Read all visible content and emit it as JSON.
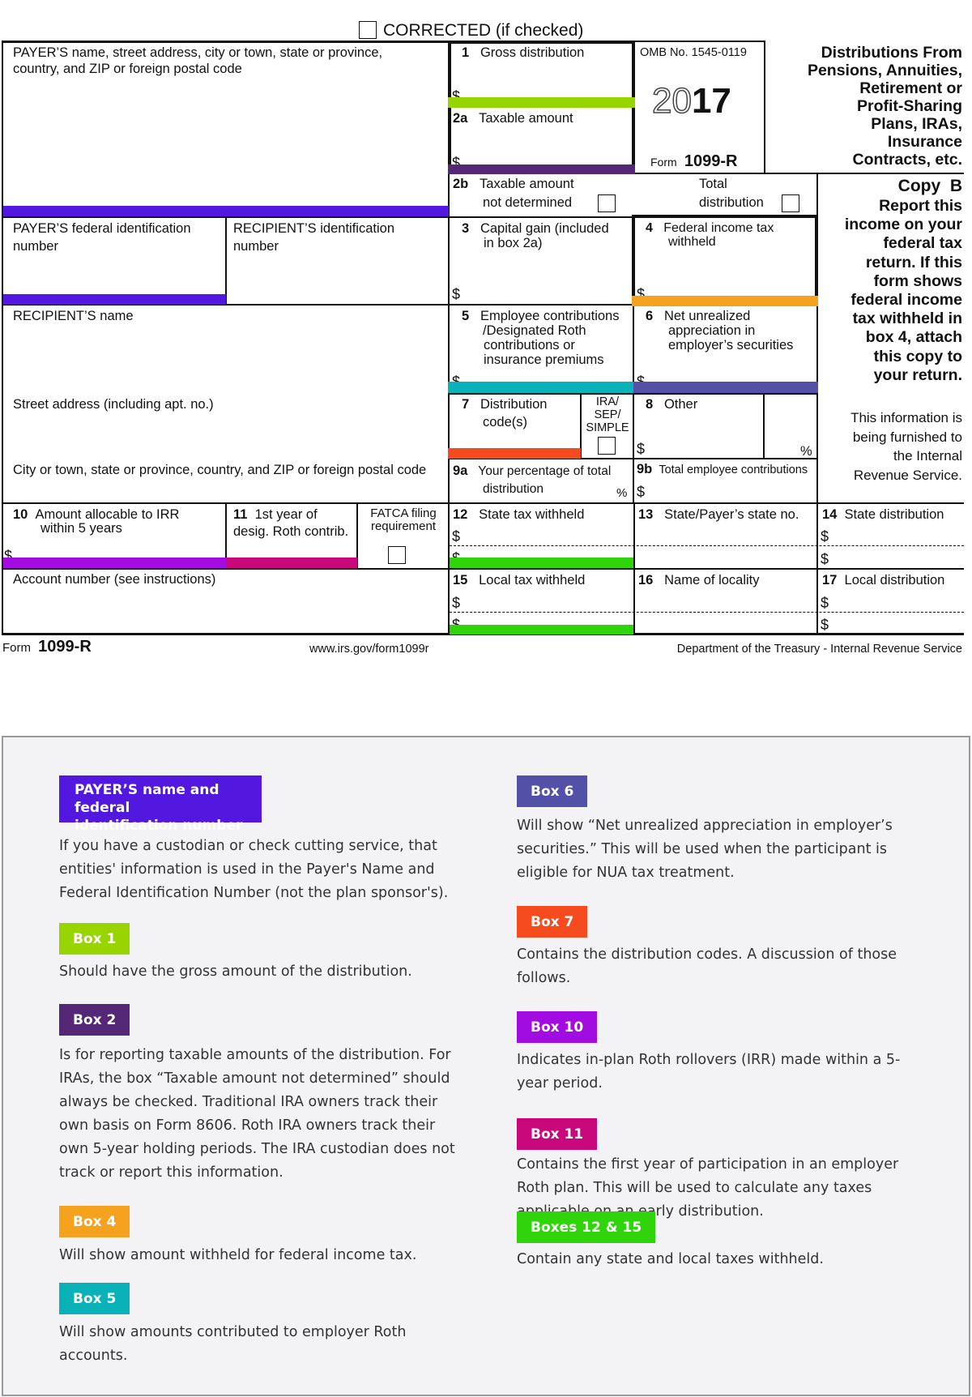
{
  "form": {
    "corrected_label": "CORRECTED (if checked)",
    "payer_name_label": "PAYER’S name, street address, city or town, state or province,",
    "payer_name_label_2": "country, and ZIP or foreign postal code",
    "payer_fed_id_label_1": "PAYER’S federal identification",
    "payer_fed_id_label_2": "number",
    "recipient_id_label_1": "RECIPIENT’S identification",
    "recipient_id_label_2": "number",
    "recipient_name_label": "RECIPIENT’S name",
    "street_label": "Street address (including apt. no.)",
    "city_label": "City or town, state or province, country, and ZIP or foreign postal code",
    "account_label": "Account number (see instructions)",
    "currency_symbol": "$",
    "percent_symbol": "%",
    "boxes": {
      "b1": {
        "num": "1",
        "label": "Gross distribution"
      },
      "b2a": {
        "num": "2a",
        "label": "Taxable amount"
      },
      "b2b": {
        "num": "2b",
        "label_1": "Taxable amount",
        "label_2": "not determined"
      },
      "total_dist": {
        "label_1": "Total",
        "label_2": "distribution"
      },
      "b3": {
        "num": "3",
        "label_1": "Capital gain (included",
        "label_2": "in box 2a)"
      },
      "b4": {
        "num": "4",
        "label_1": "Federal income tax",
        "label_2": "withheld"
      },
      "b5": {
        "num": "5",
        "label_1": "Employee contributions",
        "label_2": "/Designated Roth",
        "label_3": "contributions or",
        "label_4": "insurance premiums"
      },
      "b6": {
        "num": "6",
        "label_1": "Net unrealized",
        "label_2": "appreciation in",
        "label_3": "employer’s securities"
      },
      "b7": {
        "num": "7",
        "label_1": "Distribution",
        "label_2": "code(s)"
      },
      "ira_sep": {
        "label_1": "IRA/",
        "label_2": "SEP/",
        "label_3": "SIMPLE"
      },
      "b8": {
        "num": "8",
        "label": "Other"
      },
      "b9a": {
        "num": "9a",
        "label_1": "Your percentage of total",
        "label_2": "distribution"
      },
      "b9b": {
        "num": "9b",
        "label": "Total employee contributions"
      },
      "b10": {
        "num": "10",
        "label_1": "Amount allocable to IRR",
        "label_2": "within 5 years"
      },
      "b11": {
        "num": "11",
        "label_1": "1st year of",
        "label_2": "desig. Roth contrib."
      },
      "fatca": {
        "label_1": "FATCA filing",
        "label_2": "requirement"
      },
      "b12": {
        "num": "12",
        "label": "State tax withheld"
      },
      "b13": {
        "num": "13",
        "label": "State/Payer’s state no."
      },
      "b14": {
        "num": "14",
        "label": "State distribution"
      },
      "b15": {
        "num": "15",
        "label": "Local tax withheld"
      },
      "b16": {
        "num": "16",
        "label": "Name of locality"
      },
      "b17": {
        "num": "17",
        "label": "Local distribution"
      }
    },
    "omb": "OMB No. 1545-0119",
    "year_outline": "20",
    "year_bold": "17",
    "form_word": "Form",
    "form_number": "1099-R",
    "title_lines": [
      "Distributions From",
      "Pensions, Annuities,",
      "Retirement or",
      "Profit-Sharing",
      "Plans, IRAs,",
      "Insurance",
      "Contracts, etc."
    ],
    "copy_label": "Copy  B",
    "copy_lines": [
      "Report this",
      "income on your",
      "federal tax",
      "return. If this",
      "form shows",
      "federal income",
      "tax withheld in",
      "box 4, attach",
      "this copy to",
      "your return."
    ],
    "irs_lines": [
      "This information is",
      "being furnished to",
      "the Internal",
      "Revenue Service."
    ],
    "footer_url": "www.irs.gov/form1099r",
    "footer_dept": "Department of the Treasury - Internal Revenue Service"
  },
  "colors": {
    "payer": "#5218e0",
    "box1": "#98d400",
    "box2": "#542877",
    "box4": "#f5a31f",
    "box5": "#08b2b8",
    "box6": "#5350a7",
    "box7": "#f54b1e",
    "box10": "#a20ce0",
    "box11": "#c7077a",
    "box12_15": "#2fd40a"
  },
  "info": {
    "left": [
      {
        "tag": "PAYER’S name and federal identification number",
        "tag_lines": [
          "PAYER’S name and federal",
          "identification number"
        ],
        "color": "#5218e0",
        "text": "If you have a custodian or check cutting service, that entities' information is used in the Payer's Name and Federal Identification Number (not the plan sponsor's)."
      },
      {
        "tag": "Box 1",
        "color": "#98d400",
        "text": "Should have the gross amount of the distribution."
      },
      {
        "tag": "Box 2",
        "color": "#542877",
        "text": "Is for reporting taxable amounts of the distribution. For IRAs, the box “Taxable amount not determined” should always be checked. Traditional IRA owners track their own basis on Form 8606. Roth IRA owners track their own 5-year holding periods. The IRA custodian does not track or report this information."
      },
      {
        "tag": "Box 4",
        "color": "#f5a31f",
        "text": "Will show amount withheld for federal income tax."
      },
      {
        "tag": "Box 5",
        "color": "#08b2b8",
        "text": "Will show amounts contributed to employer Roth accounts."
      }
    ],
    "right": [
      {
        "tag": "Box 6",
        "color": "#5350a7",
        "text": "Will show “Net unrealized appreciation in employer’s securities.” This will be used when the participant is eligible for NUA tax treatment."
      },
      {
        "tag": "Box 7",
        "color": "#f54b1e",
        "text": "Contains the distribution codes. A discussion of those follows."
      },
      {
        "tag": "Box 10",
        "color": "#a20ce0",
        "text": "Indicates in-plan Roth rollovers (IRR) made within a 5-year period."
      },
      {
        "tag": "Box 11",
        "color": "#c7077a",
        "text": "Contains the first year of participation in an employer Roth plan. This will be used to calculate any taxes applicable on an early distribution."
      },
      {
        "tag": "Boxes 12 & 15",
        "color": "#2fd40a",
        "text": "Contain any state and local taxes withheld."
      }
    ]
  }
}
